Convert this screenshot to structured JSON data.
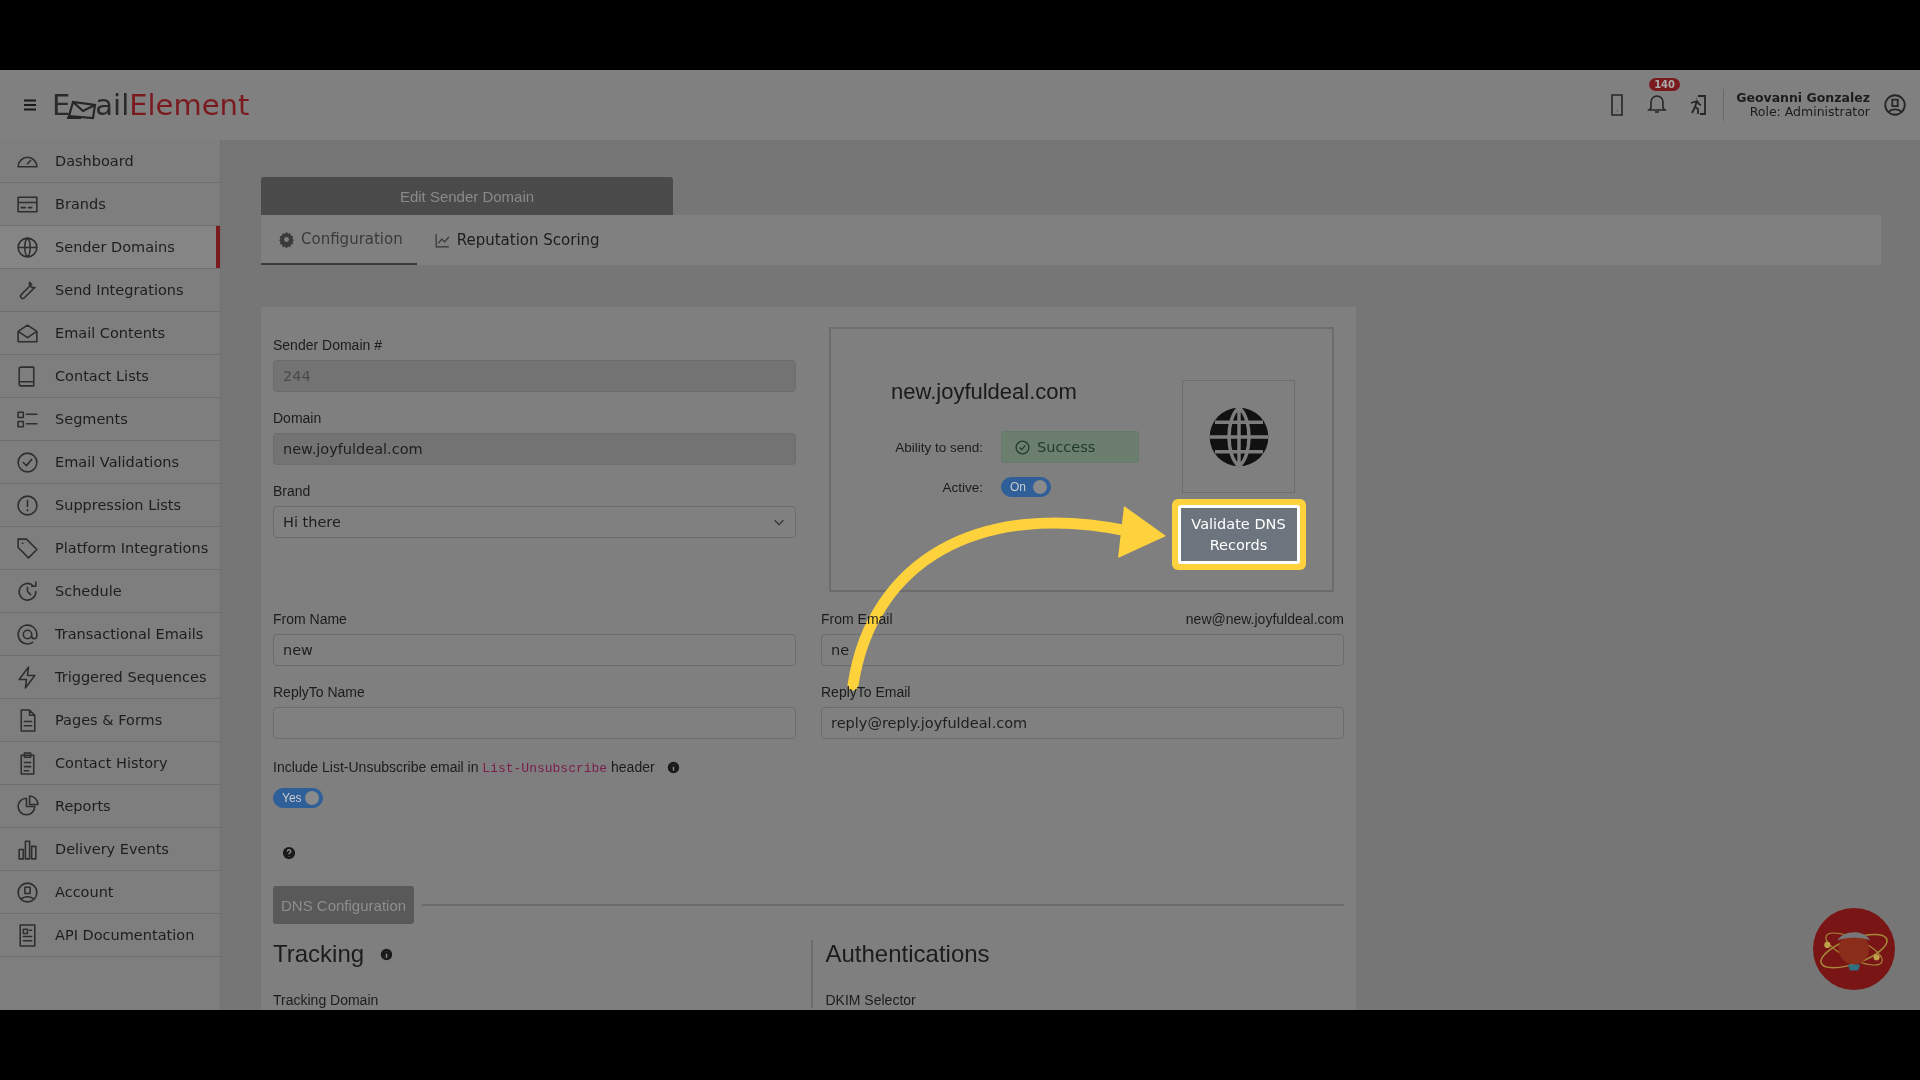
{
  "header": {
    "logo": {
      "first": "E",
      "middle": "ail",
      "last": "Element"
    },
    "notification_count": "140",
    "user_name": "Geovanni Gonzalez",
    "user_role": "Role: Administrator"
  },
  "sidebar": {
    "items": [
      {
        "label": "Dashboard",
        "selected": false
      },
      {
        "label": "Brands",
        "selected": false
      },
      {
        "label": "Sender Domains",
        "selected": true
      },
      {
        "label": "Send Integrations",
        "selected": false
      },
      {
        "label": "Email Contents",
        "selected": false
      },
      {
        "label": "Contact Lists",
        "selected": false
      },
      {
        "label": "Segments",
        "selected": false
      },
      {
        "label": "Email Validations",
        "selected": false
      },
      {
        "label": "Suppression Lists",
        "selected": false
      },
      {
        "label": "Platform Integrations",
        "selected": false
      },
      {
        "label": "Schedule",
        "selected": false
      },
      {
        "label": "Transactional Emails",
        "selected": false
      },
      {
        "label": "Triggered Sequences",
        "selected": false
      },
      {
        "label": "Pages & Forms",
        "selected": false
      },
      {
        "label": "Contact History",
        "selected": false
      },
      {
        "label": "Reports",
        "selected": false
      },
      {
        "label": "Delivery Events",
        "selected": false
      },
      {
        "label": "Account",
        "selected": false
      },
      {
        "label": "API Documentation",
        "selected": false
      }
    ]
  },
  "page_title": "Edit Sender Domain",
  "tabs": [
    {
      "label": "Configuration",
      "selected": true
    },
    {
      "label": "Reputation Scoring",
      "selected": false
    }
  ],
  "fields_top": [
    {
      "kind": "text",
      "label": "Sender Domain #",
      "value": "244",
      "disabled": true
    },
    {
      "kind": "text",
      "label": "Domain",
      "value": "new.joyfuldeal.com",
      "disabled": true
    },
    {
      "kind": "select",
      "label": "Brand",
      "value": "Hi there",
      "disabled": false
    }
  ],
  "domain_card": {
    "domain": "new.joyfuldeal.com",
    "ability_label": "Ability to send:",
    "ability_status": "Success",
    "active_label": "Active:",
    "active": {
      "label": "On",
      "on": true
    },
    "validate_button": "Validate DNS Records"
  },
  "fields_bottom": [
    {
      "label": "From Name",
      "value": "new"
    },
    {
      "label": "From Email",
      "value": "ne",
      "hint": "new@new.joyfuldeal.com"
    },
    {
      "label": "ReplyTo Name"
    },
    {
      "label": "ReplyTo Email",
      "value": "reply@reply.joyfuldeal.com"
    }
  ],
  "unsubscribe": {
    "before": "Include List-Unsubscribe email in ",
    "code": "List-Unsubscribe",
    "after": " header",
    "toggle": {
      "label": "Yes",
      "on": true
    }
  },
  "dns_button": "DNS Configuration",
  "sections": [
    {
      "title": "Tracking",
      "info": true,
      "field_label": "Tracking Domain"
    },
    {
      "title": "Authentications",
      "info": false,
      "field_label": "DKIM Selector"
    }
  ]
}
